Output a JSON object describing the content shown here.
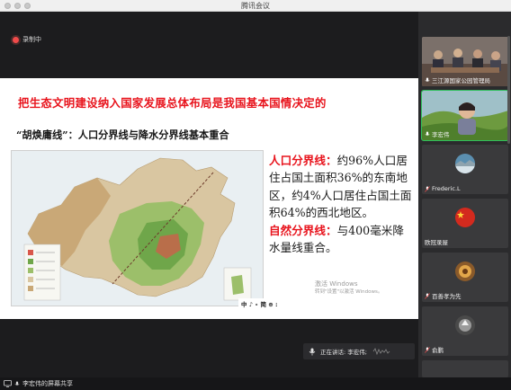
{
  "window": {
    "title": "腾讯会议"
  },
  "recording": {
    "label": "录制中"
  },
  "slide": {
    "title": "把生态文明建设纳入国家发展总体布局是我国基本国情决定的",
    "subtitle": "“胡焕庸线”：人口分界线与降水分界线基本重合",
    "para1_head": "人口分界线：",
    "para1_body": "约96%人口居住占国土面积36%的东南地区，约4%人口居住占国土面积64%的西北地区。",
    "para2_head": "自然分界线：",
    "para2_body": "与400毫米降水量线重合。"
  },
  "watermark": {
    "line1": "激活 Windows",
    "line2": "转到\"设置\"以激活 Windows。"
  },
  "presenter_toolbar": {
    "label": "中 ♪ ∘ 简 ⊕ :"
  },
  "speaking": {
    "label": "正在讲话: 李宏伟;"
  },
  "bottom_bar": {
    "label": "李宏伟的屏幕共享"
  },
  "participants": [
    {
      "name": "三江源国家公园管理局",
      "type": "video",
      "muted": false
    },
    {
      "name": "李宏伟",
      "type": "video",
      "muted": false
    },
    {
      "name": "Frederic.L",
      "type": "avatar",
      "muted": true
    },
    {
      "name": "欧冠录屋",
      "type": "avatar",
      "muted": false
    },
    {
      "name": "百善孝为先",
      "type": "avatar",
      "muted": true
    },
    {
      "name": "俞鹏",
      "type": "avatar",
      "muted": true
    }
  ],
  "colors": {
    "accent_red": "#e8141d",
    "background": "#1c1c1e",
    "sidebar": "#2b2b2d"
  },
  "icons": [
    "record-icon",
    "microphone-icon",
    "microphone-muted-icon",
    "share-screen-icon",
    "audio-wave-icon"
  ]
}
